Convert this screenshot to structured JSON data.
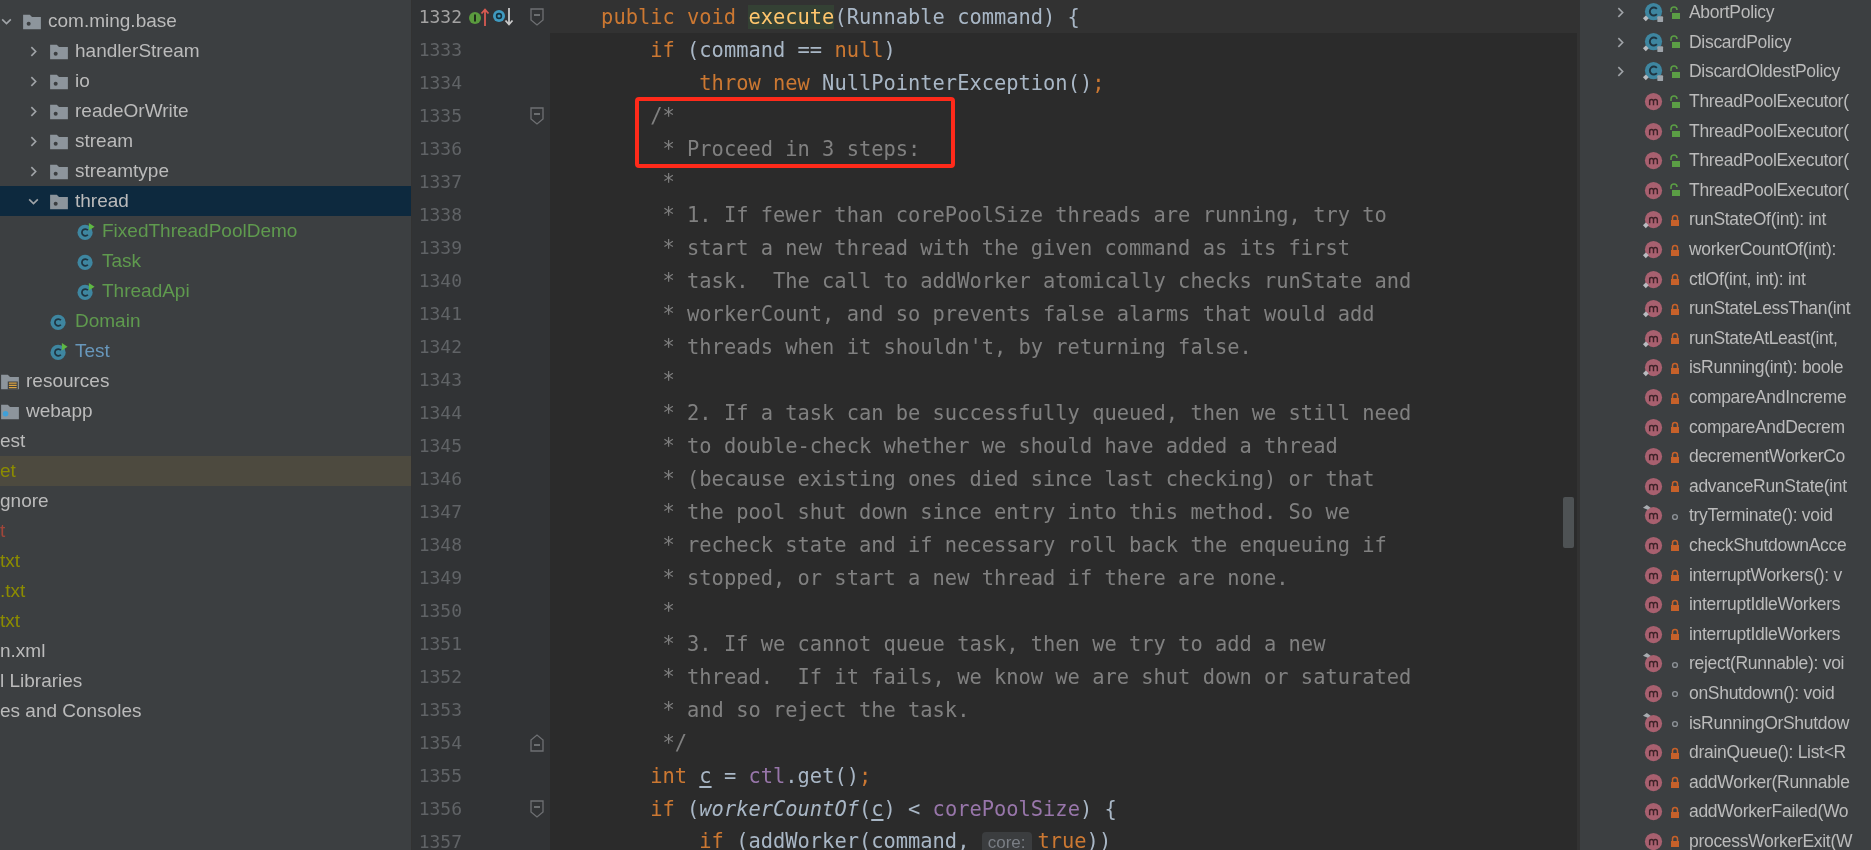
{
  "project_tree": [
    {
      "label": "com.ming.base",
      "kind": "package",
      "expanded": true,
      "selected": false,
      "highlighted": false,
      "children": [
        {
          "label": "handlerStream",
          "kind": "package",
          "expanded": false,
          "selected": false,
          "highlighted": false
        },
        {
          "label": "io",
          "kind": "package",
          "expanded": false,
          "selected": false,
          "highlighted": false
        },
        {
          "label": "readeOrWrite",
          "kind": "package",
          "expanded": false,
          "selected": false,
          "highlighted": false
        },
        {
          "label": "stream",
          "kind": "package",
          "expanded": false,
          "selected": false,
          "highlighted": false
        },
        {
          "label": "streamtype",
          "kind": "package",
          "expanded": false,
          "selected": false,
          "highlighted": false
        },
        {
          "label": "thread",
          "kind": "package",
          "expanded": true,
          "selected": true,
          "highlighted": false,
          "children": [
            {
              "label": "FixedThreadPoolDemo",
              "kind": "main-class",
              "color": "#5f9a4e",
              "selected": false,
              "highlighted": false
            },
            {
              "label": "Task",
              "kind": "class",
              "color": "#5f9a4e",
              "selected": false,
              "highlighted": false
            },
            {
              "label": "ThreadApi",
              "kind": "main-class",
              "color": "#5f9a4e",
              "selected": false,
              "highlighted": false
            }
          ]
        },
        {
          "label": "Domain",
          "kind": "class",
          "color": "#5f9a4e",
          "selected": false,
          "highlighted": false
        },
        {
          "label": "Test",
          "kind": "main-class",
          "color": "#6897bb",
          "selected": false,
          "highlighted": false
        }
      ]
    },
    {
      "label": "resources",
      "kind": "resources-folder",
      "selected": false,
      "highlighted": false
    },
    {
      "label": "webapp",
      "kind": "web-folder",
      "selected": false,
      "highlighted": false
    },
    {
      "label": "est",
      "kind": "file",
      "selected": false,
      "highlighted": false
    },
    {
      "label": "et",
      "kind": "file",
      "color": "#8c8c00",
      "selected": false,
      "highlighted": true
    },
    {
      "label": "gnore",
      "kind": "file",
      "selected": false,
      "highlighted": false
    },
    {
      "label": "t",
      "kind": "file",
      "color": "#a0463a",
      "selected": false,
      "highlighted": false
    },
    {
      "label": "txt",
      "kind": "file",
      "color": "#8c8c00",
      "selected": false,
      "highlighted": false
    },
    {
      "label": ".txt",
      "kind": "file",
      "color": "#8c8c00",
      "selected": false,
      "highlighted": false
    },
    {
      "label": "txt",
      "kind": "file",
      "color": "#8c8c00",
      "selected": false,
      "highlighted": false
    },
    {
      "label": "n.xml",
      "kind": "file",
      "selected": false,
      "highlighted": false
    },
    {
      "label": "l Libraries",
      "kind": "file",
      "selected": false,
      "highlighted": false
    },
    {
      "label": "es and Consoles",
      "kind": "file",
      "selected": false,
      "highlighted": false
    }
  ],
  "editor": {
    "lines": [
      {
        "number": "1332",
        "kind": "fold-start",
        "current": true,
        "gutter_icons": [
          {
            "kind": "implements"
          },
          {
            "kind": "overridden"
          }
        ],
        "tokens": [
          {
            "kind": "kw",
            "text": "    public void "
          },
          {
            "kind": "decl",
            "text": "execute"
          },
          {
            "kind": "plain",
            "text": "(Runnable command) {"
          }
        ]
      },
      {
        "number": "1333",
        "kind": "plain",
        "current": false,
        "tokens": [
          {
            "kind": "kw",
            "text": "        if"
          },
          {
            "kind": "plain",
            "text": " (command == "
          },
          {
            "kind": "kw",
            "text": "null"
          },
          {
            "kind": "plain",
            "text": ")"
          }
        ]
      },
      {
        "number": "1334",
        "kind": "plain",
        "current": false,
        "tokens": [
          {
            "kind": "kw",
            "text": "            throw new"
          },
          {
            "kind": "plain",
            "text": " NullPointerException()"
          },
          {
            "kind": "kw",
            "text": ";"
          }
        ]
      },
      {
        "number": "1335",
        "kind": "fold-start",
        "current": false,
        "tokens": [
          {
            "kind": "comment",
            "text": "        /*"
          }
        ]
      },
      {
        "number": "1336",
        "kind": "plain",
        "current": false,
        "tokens": [
          {
            "kind": "comment",
            "text": "         * Proceed in 3 steps:"
          }
        ]
      },
      {
        "number": "1337",
        "kind": "plain",
        "current": false,
        "tokens": [
          {
            "kind": "comment",
            "text": "         *"
          }
        ]
      },
      {
        "number": "1338",
        "kind": "plain",
        "current": false,
        "tokens": [
          {
            "kind": "comment",
            "text": "         * 1. If fewer than corePoolSize threads are running, try to"
          }
        ]
      },
      {
        "number": "1339",
        "kind": "plain",
        "current": false,
        "tokens": [
          {
            "kind": "comment",
            "text": "         * start a new thread with the given command as its first"
          }
        ]
      },
      {
        "number": "1340",
        "kind": "plain",
        "current": false,
        "tokens": [
          {
            "kind": "comment",
            "text": "         * task.  The call to addWorker atomically checks runState and"
          }
        ]
      },
      {
        "number": "1341",
        "kind": "plain",
        "current": false,
        "tokens": [
          {
            "kind": "comment",
            "text": "         * workerCount, and so prevents false alarms that would add"
          }
        ]
      },
      {
        "number": "1342",
        "kind": "plain",
        "current": false,
        "tokens": [
          {
            "kind": "comment",
            "text": "         * threads when it shouldn't, by returning false."
          }
        ]
      },
      {
        "number": "1343",
        "kind": "plain",
        "current": false,
        "tokens": [
          {
            "kind": "comment",
            "text": "         *"
          }
        ]
      },
      {
        "number": "1344",
        "kind": "plain",
        "current": false,
        "tokens": [
          {
            "kind": "comment",
            "text": "         * 2. If a task can be successfully queued, then we still need"
          }
        ]
      },
      {
        "number": "1345",
        "kind": "plain",
        "current": false,
        "tokens": [
          {
            "kind": "comment",
            "text": "         * to double-check whether we should have added a thread"
          }
        ]
      },
      {
        "number": "1346",
        "kind": "plain",
        "current": false,
        "tokens": [
          {
            "kind": "comment",
            "text": "         * (because existing ones died since last checking) or that"
          }
        ]
      },
      {
        "number": "1347",
        "kind": "plain",
        "current": false,
        "tokens": [
          {
            "kind": "comment",
            "text": "         * the pool shut down since entry into this method. So we"
          }
        ]
      },
      {
        "number": "1348",
        "kind": "plain",
        "current": false,
        "tokens": [
          {
            "kind": "comment",
            "text": "         * recheck state and if necessary roll back the enqueuing if"
          }
        ]
      },
      {
        "number": "1349",
        "kind": "plain",
        "current": false,
        "tokens": [
          {
            "kind": "comment",
            "text": "         * stopped, or start a new thread if there are none."
          }
        ]
      },
      {
        "number": "1350",
        "kind": "plain",
        "current": false,
        "tokens": [
          {
            "kind": "comment",
            "text": "         *"
          }
        ]
      },
      {
        "number": "1351",
        "kind": "plain",
        "current": false,
        "tokens": [
          {
            "kind": "comment",
            "text": "         * 3. If we cannot queue task, then we try to add a new"
          }
        ]
      },
      {
        "number": "1352",
        "kind": "plain",
        "current": false,
        "tokens": [
          {
            "kind": "comment",
            "text": "         * thread.  If it fails, we know we are shut down or saturated"
          }
        ]
      },
      {
        "number": "1353",
        "kind": "plain",
        "current": false,
        "tokens": [
          {
            "kind": "comment",
            "text": "         * and so reject the task."
          }
        ]
      },
      {
        "number": "1354",
        "kind": "fold-end",
        "current": false,
        "tokens": [
          {
            "kind": "comment",
            "text": "         */"
          }
        ]
      },
      {
        "number": "1355",
        "kind": "plain",
        "current": false,
        "tokens": [
          {
            "kind": "kw",
            "text": "        int "
          },
          {
            "kind": "local",
            "text": "c"
          },
          {
            "kind": "plain",
            "text": " = "
          },
          {
            "kind": "field",
            "text": "ctl"
          },
          {
            "kind": "plain",
            "text": ".get()"
          },
          {
            "kind": "kw",
            "text": ";"
          }
        ]
      },
      {
        "number": "1356",
        "kind": "fold-start",
        "current": false,
        "tokens": [
          {
            "kind": "kw",
            "text": "        if"
          },
          {
            "kind": "plain",
            "text": " ("
          },
          {
            "kind": "static",
            "text": "workerCountOf"
          },
          {
            "kind": "plain",
            "text": "("
          },
          {
            "kind": "local",
            "text": "c"
          },
          {
            "kind": "plain",
            "text": ") < "
          },
          {
            "kind": "field",
            "text": "corePoolSize"
          },
          {
            "kind": "plain",
            "text": ") {"
          }
        ]
      },
      {
        "number": "1357",
        "kind": "plain",
        "current": false,
        "tokens": [
          {
            "kind": "kw",
            "text": "            if"
          },
          {
            "kind": "plain",
            "text": " (addWorker(command, "
          },
          {
            "kind": "hint",
            "text": "core:"
          },
          {
            "kind": "kw",
            "text": "true"
          },
          {
            "kind": "plain",
            "text": "))"
          }
        ]
      }
    ]
  },
  "structure": [
    {
      "label": "AbortPolicy",
      "kind": "class-public-static",
      "expanded": false
    },
    {
      "label": "DiscardPolicy",
      "kind": "class-public-static",
      "expanded": false
    },
    {
      "label": "DiscardOldestPolicy",
      "kind": "class-public-static",
      "expanded": false
    },
    {
      "label": "ThreadPoolExecutor(",
      "kind": "method-public"
    },
    {
      "label": "ThreadPoolExecutor(",
      "kind": "method-public"
    },
    {
      "label": "ThreadPoolExecutor(",
      "kind": "method-public"
    },
    {
      "label": "ThreadPoolExecutor(",
      "kind": "method-public"
    },
    {
      "label": "runStateOf(int): int",
      "kind": "method-private-static"
    },
    {
      "label": "workerCountOf(int):",
      "kind": "method-private-static"
    },
    {
      "label": "ctlOf(int, int): int",
      "kind": "method-private-static"
    },
    {
      "label": "runStateLessThan(int",
      "kind": "method-private-static"
    },
    {
      "label": "runStateAtLeast(int,",
      "kind": "method-private-static"
    },
    {
      "label": "isRunning(int): boole",
      "kind": "method-private-static"
    },
    {
      "label": "compareAndIncreme",
      "kind": "method-private"
    },
    {
      "label": "compareAndDecrem",
      "kind": "method-private"
    },
    {
      "label": "decrementWorkerCo",
      "kind": "method-private"
    },
    {
      "label": "advanceRunState(int",
      "kind": "method-private"
    },
    {
      "label": "tryTerminate(): void",
      "kind": "method-package-override"
    },
    {
      "label": "checkShutdownAcce",
      "kind": "method-private"
    },
    {
      "label": "interruptWorkers(): v",
      "kind": "method-private"
    },
    {
      "label": "interruptIdleWorkers",
      "kind": "method-private"
    },
    {
      "label": "interruptIdleWorkers",
      "kind": "method-private"
    },
    {
      "label": "reject(Runnable): voi",
      "kind": "method-package-override"
    },
    {
      "label": "onShutdown(): void",
      "kind": "method-package"
    },
    {
      "label": "isRunningOrShutdow",
      "kind": "method-package-override"
    },
    {
      "label": "drainQueue(): List<R",
      "kind": "method-private"
    },
    {
      "label": "addWorker(Runnable",
      "kind": "method-private"
    },
    {
      "label": "addWorkerFailed(Wo",
      "kind": "method-private"
    },
    {
      "label": "processWorkerExit(W",
      "kind": "method-private"
    }
  ]
}
